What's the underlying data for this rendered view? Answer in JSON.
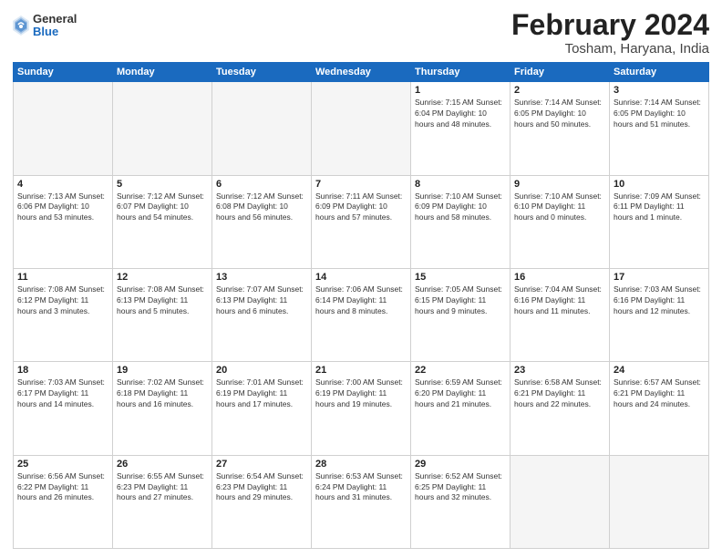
{
  "logo": {
    "general": "General",
    "blue": "Blue"
  },
  "title": "February 2024",
  "subtitle": "Tosham, Haryana, India",
  "days": [
    "Sunday",
    "Monday",
    "Tuesday",
    "Wednesday",
    "Thursday",
    "Friday",
    "Saturday"
  ],
  "weeks": [
    [
      {
        "day": "",
        "content": ""
      },
      {
        "day": "",
        "content": ""
      },
      {
        "day": "",
        "content": ""
      },
      {
        "day": "",
        "content": ""
      },
      {
        "day": "1",
        "content": "Sunrise: 7:15 AM\nSunset: 6:04 PM\nDaylight: 10 hours\nand 48 minutes."
      },
      {
        "day": "2",
        "content": "Sunrise: 7:14 AM\nSunset: 6:05 PM\nDaylight: 10 hours\nand 50 minutes."
      },
      {
        "day": "3",
        "content": "Sunrise: 7:14 AM\nSunset: 6:05 PM\nDaylight: 10 hours\nand 51 minutes."
      }
    ],
    [
      {
        "day": "4",
        "content": "Sunrise: 7:13 AM\nSunset: 6:06 PM\nDaylight: 10 hours\nand 53 minutes."
      },
      {
        "day": "5",
        "content": "Sunrise: 7:12 AM\nSunset: 6:07 PM\nDaylight: 10 hours\nand 54 minutes."
      },
      {
        "day": "6",
        "content": "Sunrise: 7:12 AM\nSunset: 6:08 PM\nDaylight: 10 hours\nand 56 minutes."
      },
      {
        "day": "7",
        "content": "Sunrise: 7:11 AM\nSunset: 6:09 PM\nDaylight: 10 hours\nand 57 minutes."
      },
      {
        "day": "8",
        "content": "Sunrise: 7:10 AM\nSunset: 6:09 PM\nDaylight: 10 hours\nand 58 minutes."
      },
      {
        "day": "9",
        "content": "Sunrise: 7:10 AM\nSunset: 6:10 PM\nDaylight: 11 hours\nand 0 minutes."
      },
      {
        "day": "10",
        "content": "Sunrise: 7:09 AM\nSunset: 6:11 PM\nDaylight: 11 hours\nand 1 minute."
      }
    ],
    [
      {
        "day": "11",
        "content": "Sunrise: 7:08 AM\nSunset: 6:12 PM\nDaylight: 11 hours\nand 3 minutes."
      },
      {
        "day": "12",
        "content": "Sunrise: 7:08 AM\nSunset: 6:13 PM\nDaylight: 11 hours\nand 5 minutes."
      },
      {
        "day": "13",
        "content": "Sunrise: 7:07 AM\nSunset: 6:13 PM\nDaylight: 11 hours\nand 6 minutes."
      },
      {
        "day": "14",
        "content": "Sunrise: 7:06 AM\nSunset: 6:14 PM\nDaylight: 11 hours\nand 8 minutes."
      },
      {
        "day": "15",
        "content": "Sunrise: 7:05 AM\nSunset: 6:15 PM\nDaylight: 11 hours\nand 9 minutes."
      },
      {
        "day": "16",
        "content": "Sunrise: 7:04 AM\nSunset: 6:16 PM\nDaylight: 11 hours\nand 11 minutes."
      },
      {
        "day": "17",
        "content": "Sunrise: 7:03 AM\nSunset: 6:16 PM\nDaylight: 11 hours\nand 12 minutes."
      }
    ],
    [
      {
        "day": "18",
        "content": "Sunrise: 7:03 AM\nSunset: 6:17 PM\nDaylight: 11 hours\nand 14 minutes."
      },
      {
        "day": "19",
        "content": "Sunrise: 7:02 AM\nSunset: 6:18 PM\nDaylight: 11 hours\nand 16 minutes."
      },
      {
        "day": "20",
        "content": "Sunrise: 7:01 AM\nSunset: 6:19 PM\nDaylight: 11 hours\nand 17 minutes."
      },
      {
        "day": "21",
        "content": "Sunrise: 7:00 AM\nSunset: 6:19 PM\nDaylight: 11 hours\nand 19 minutes."
      },
      {
        "day": "22",
        "content": "Sunrise: 6:59 AM\nSunset: 6:20 PM\nDaylight: 11 hours\nand 21 minutes."
      },
      {
        "day": "23",
        "content": "Sunrise: 6:58 AM\nSunset: 6:21 PM\nDaylight: 11 hours\nand 22 minutes."
      },
      {
        "day": "24",
        "content": "Sunrise: 6:57 AM\nSunset: 6:21 PM\nDaylight: 11 hours\nand 24 minutes."
      }
    ],
    [
      {
        "day": "25",
        "content": "Sunrise: 6:56 AM\nSunset: 6:22 PM\nDaylight: 11 hours\nand 26 minutes."
      },
      {
        "day": "26",
        "content": "Sunrise: 6:55 AM\nSunset: 6:23 PM\nDaylight: 11 hours\nand 27 minutes."
      },
      {
        "day": "27",
        "content": "Sunrise: 6:54 AM\nSunset: 6:23 PM\nDaylight: 11 hours\nand 29 minutes."
      },
      {
        "day": "28",
        "content": "Sunrise: 6:53 AM\nSunset: 6:24 PM\nDaylight: 11 hours\nand 31 minutes."
      },
      {
        "day": "29",
        "content": "Sunrise: 6:52 AM\nSunset: 6:25 PM\nDaylight: 11 hours\nand 32 minutes."
      },
      {
        "day": "",
        "content": ""
      },
      {
        "day": "",
        "content": ""
      }
    ]
  ]
}
